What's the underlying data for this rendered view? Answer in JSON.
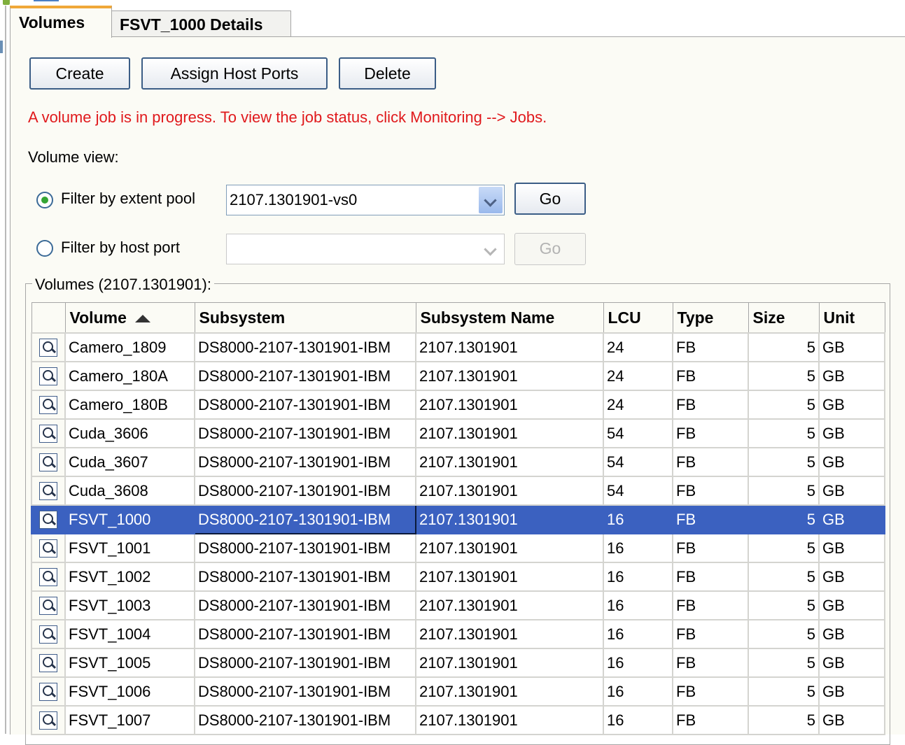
{
  "tabs": [
    {
      "label": "Volumes",
      "active": true
    },
    {
      "label": "FSVT_1000 Details",
      "active": false
    }
  ],
  "toolbar": {
    "create_label": "Create",
    "assign_label": "Assign Host Ports",
    "delete_label": "Delete"
  },
  "message": "A volume job is in progress. To view the job status, click Monitoring --> Jobs.",
  "volume_view": {
    "label": "Volume view:",
    "filter_pool_label": "Filter by extent pool",
    "filter_pool_value": "2107.1301901-vs0",
    "filter_pool_selected": true,
    "go_label": "Go",
    "filter_port_label": "Filter by host port",
    "filter_port_value": "",
    "filter_port_selected": false,
    "go2_label": "Go"
  },
  "volumes_group": {
    "title": "Volumes (2107.1301901):"
  },
  "table": {
    "headers": {
      "volume": "Volume",
      "subsystem": "Subsystem",
      "subsystem_name": "Subsystem Name",
      "lcu": "LCU",
      "type": "Type",
      "size": "Size",
      "unit": "Unit"
    },
    "sorted_by": "Volume",
    "selected_row": 6,
    "rows": [
      {
        "volume": "Camero_1809",
        "subsystem": "DS8000-2107-1301901-IBM",
        "subsystem_name": "2107.1301901",
        "lcu": "24",
        "type": "FB",
        "size": "5",
        "unit": "GB"
      },
      {
        "volume": "Camero_180A",
        "subsystem": "DS8000-2107-1301901-IBM",
        "subsystem_name": "2107.1301901",
        "lcu": "24",
        "type": "FB",
        "size": "5",
        "unit": "GB"
      },
      {
        "volume": "Camero_180B",
        "subsystem": "DS8000-2107-1301901-IBM",
        "subsystem_name": "2107.1301901",
        "lcu": "24",
        "type": "FB",
        "size": "5",
        "unit": "GB"
      },
      {
        "volume": "Cuda_3606",
        "subsystem": "DS8000-2107-1301901-IBM",
        "subsystem_name": "2107.1301901",
        "lcu": "54",
        "type": "FB",
        "size": "5",
        "unit": "GB"
      },
      {
        "volume": "Cuda_3607",
        "subsystem": "DS8000-2107-1301901-IBM",
        "subsystem_name": "2107.1301901",
        "lcu": "54",
        "type": "FB",
        "size": "5",
        "unit": "GB"
      },
      {
        "volume": "Cuda_3608",
        "subsystem": "DS8000-2107-1301901-IBM",
        "subsystem_name": "2107.1301901",
        "lcu": "54",
        "type": "FB",
        "size": "5",
        "unit": "GB"
      },
      {
        "volume": "FSVT_1000",
        "subsystem": "DS8000-2107-1301901-IBM",
        "subsystem_name": "2107.1301901",
        "lcu": "16",
        "type": "FB",
        "size": "5",
        "unit": "GB"
      },
      {
        "volume": "FSVT_1001",
        "subsystem": "DS8000-2107-1301901-IBM",
        "subsystem_name": "2107.1301901",
        "lcu": "16",
        "type": "FB",
        "size": "5",
        "unit": "GB"
      },
      {
        "volume": "FSVT_1002",
        "subsystem": "DS8000-2107-1301901-IBM",
        "subsystem_name": "2107.1301901",
        "lcu": "16",
        "type": "FB",
        "size": "5",
        "unit": "GB"
      },
      {
        "volume": "FSVT_1003",
        "subsystem": "DS8000-2107-1301901-IBM",
        "subsystem_name": "2107.1301901",
        "lcu": "16",
        "type": "FB",
        "size": "5",
        "unit": "GB"
      },
      {
        "volume": "FSVT_1004",
        "subsystem": "DS8000-2107-1301901-IBM",
        "subsystem_name": "2107.1301901",
        "lcu": "16",
        "type": "FB",
        "size": "5",
        "unit": "GB"
      },
      {
        "volume": "FSVT_1005",
        "subsystem": "DS8000-2107-1301901-IBM",
        "subsystem_name": "2107.1301901",
        "lcu": "16",
        "type": "FB",
        "size": "5",
        "unit": "GB"
      },
      {
        "volume": "FSVT_1006",
        "subsystem": "DS8000-2107-1301901-IBM",
        "subsystem_name": "2107.1301901",
        "lcu": "16",
        "type": "FB",
        "size": "5",
        "unit": "GB"
      },
      {
        "volume": "FSVT_1007",
        "subsystem": "DS8000-2107-1301901-IBM",
        "subsystem_name": "2107.1301901",
        "lcu": "16",
        "type": "FB",
        "size": "5",
        "unit": "GB"
      }
    ],
    "row_icon": "magnifier-icon"
  },
  "colors": {
    "message": "#e0191c",
    "selection": "#3b61c0",
    "active_tab_accent": "#f0a738",
    "radio_checked": "#35a534"
  }
}
